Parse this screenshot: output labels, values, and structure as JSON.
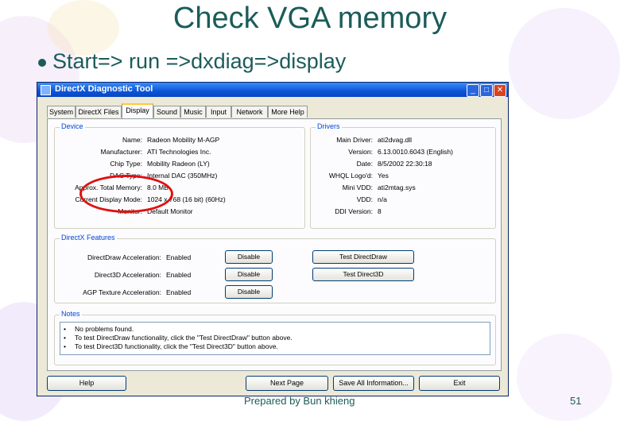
{
  "slide": {
    "title": "Check VGA memory",
    "bullet": "Start=> run =>dxdiag=>display",
    "footer_text": "Prepared by Bun khieng",
    "page_number": "51"
  },
  "window": {
    "title": "DirectX Diagnostic Tool",
    "tabs": [
      {
        "label": "System",
        "active": false
      },
      {
        "label": "DirectX Files",
        "active": false
      },
      {
        "label": "Display",
        "active": true
      },
      {
        "label": "Sound",
        "active": false
      },
      {
        "label": "Music",
        "active": false
      },
      {
        "label": "Input",
        "active": false
      },
      {
        "label": "Network",
        "active": false
      },
      {
        "label": "More Help",
        "active": false
      }
    ],
    "device": {
      "group_label": "Device",
      "rows": [
        {
          "key": "Name:",
          "value": "Radeon Mobility M-AGP"
        },
        {
          "key": "Manufacturer:",
          "value": "ATI Technologies Inc."
        },
        {
          "key": "Chip Type:",
          "value": "Mobility Radeon (LY)"
        },
        {
          "key": "DAC Type:",
          "value": "Internal DAC (350MHz)"
        },
        {
          "key": "Approx. Total Memory:",
          "value": "8.0 MB"
        },
        {
          "key": "Current Display Mode:",
          "value": "1024 x 768 (16 bit) (60Hz)"
        },
        {
          "key": "Monitor:",
          "value": "Default Monitor"
        }
      ]
    },
    "drivers": {
      "group_label": "Drivers",
      "rows": [
        {
          "key": "Main Driver:",
          "value": "ati2dvag.dll"
        },
        {
          "key": "Version:",
          "value": "6.13.0010.6043 (English)"
        },
        {
          "key": "Date:",
          "value": "8/5/2002 22:30:18"
        },
        {
          "key": "WHQL Logo'd:",
          "value": "Yes"
        },
        {
          "key": "Mini VDD:",
          "value": "ati2mtag.sys"
        },
        {
          "key": "VDD:",
          "value": "n/a"
        },
        {
          "key": "DDI Version:",
          "value": "8"
        }
      ]
    },
    "features": {
      "group_label": "DirectX Features",
      "rows": [
        {
          "key": "DirectDraw Acceleration:",
          "value": "Enabled",
          "button": "Disable",
          "test_button": "Test DirectDraw"
        },
        {
          "key": "Direct3D Acceleration:",
          "value": "Enabled",
          "button": "Disable",
          "test_button": "Test Direct3D"
        },
        {
          "key": "AGP Texture Acceleration:",
          "value": "Enabled",
          "button": "Disable"
        }
      ]
    },
    "notes": {
      "group_label": "Notes",
      "items": [
        "No problems found.",
        "To test DirectDraw functionality, click the \"Test DirectDraw\" button above.",
        "To test Direct3D functionality, click the \"Test Direct3D\" button above."
      ]
    },
    "bottom_buttons": {
      "help": "Help",
      "next_page": "Next Page",
      "save_all": "Save All Information...",
      "exit": "Exit"
    }
  },
  "colors": {
    "slide_text": "#1b5c5a",
    "xp_title_blue": "#0a55d8",
    "highlight_red": "#e01010",
    "group_label_blue": "#0046d5"
  }
}
